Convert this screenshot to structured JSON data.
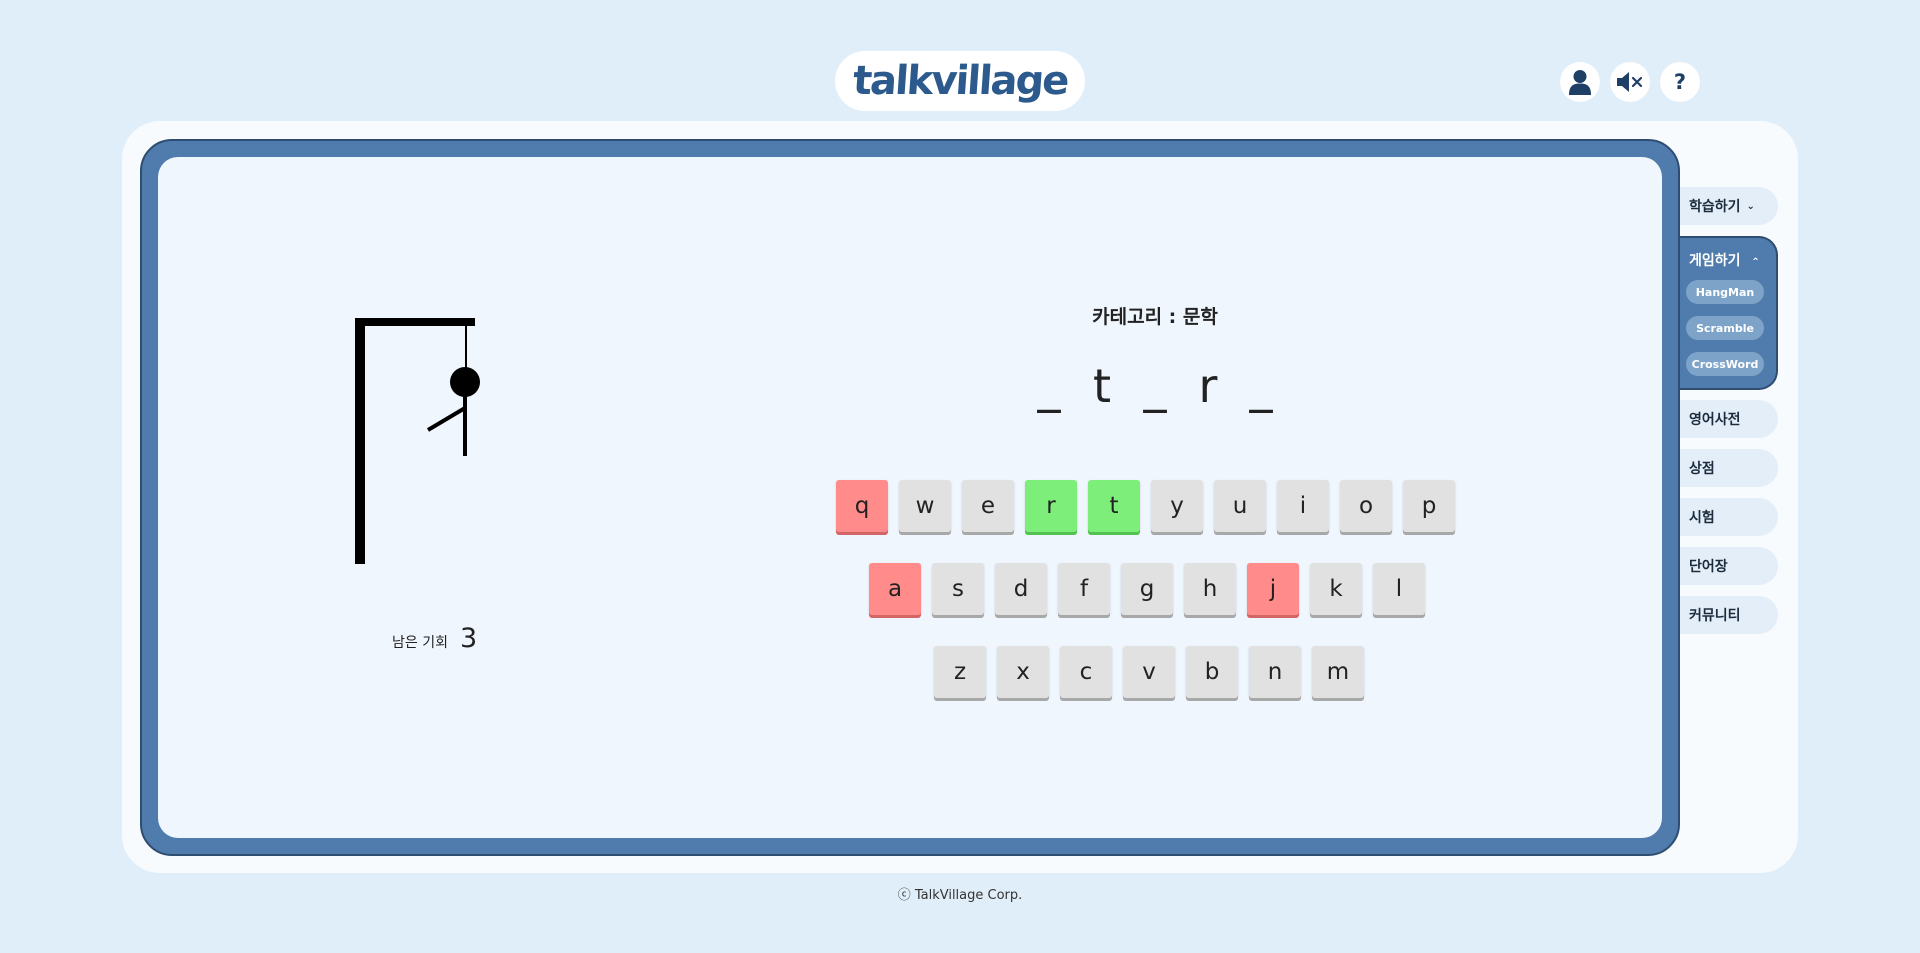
{
  "header": {
    "logo_text": "talkvillage",
    "icons": [
      "user-icon",
      "mute-icon",
      "help-icon"
    ],
    "help_label": "?"
  },
  "hangman": {
    "lives_label": "남은 기회",
    "lives_remaining": "3"
  },
  "game": {
    "category": "카테고리 : 문학",
    "word_slots": [
      "_",
      "t",
      "_",
      "r",
      "_"
    ],
    "keyboard": {
      "row1": [
        "q",
        "w",
        "e",
        "r",
        "t",
        "y",
        "u",
        "i",
        "o",
        "p"
      ],
      "row2": [
        "a",
        "s",
        "d",
        "f",
        "g",
        "h",
        "j",
        "k",
        "l"
      ],
      "row3": [
        "z",
        "x",
        "c",
        "v",
        "b",
        "n",
        "m"
      ]
    },
    "correct_letters": [
      "r",
      "t"
    ],
    "wrong_letters": [
      "q",
      "a",
      "j"
    ]
  },
  "nav": {
    "learn": "학습하기",
    "game": "게임하기",
    "game_items": [
      "HangMan",
      "Scramble",
      "CrossWord"
    ],
    "dictionary": "영어사전",
    "shop": "상점",
    "exam": "시험",
    "wordbook": "단어장",
    "community": "커뮤니티"
  },
  "colors": {
    "background": "#e0eef9",
    "frame_blue": "#4f7bad",
    "correct_key": "#7dee7a",
    "wrong_key": "#ff8b8b",
    "default_key": "#e1e1e1"
  },
  "footer": "ⓒ TalkVillage Corp."
}
